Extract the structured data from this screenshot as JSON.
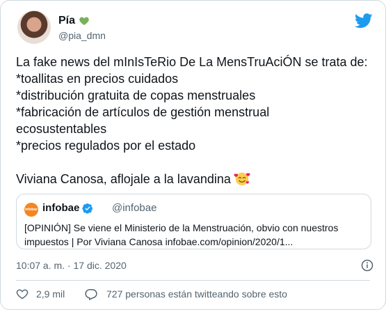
{
  "tweet": {
    "author_name": "Pía",
    "author_handle": "@pia_dmn",
    "text_lines": [
      "La fake news del mInIsTeRio De La MensTruAciÓN se trata de:",
      "*toallitas en precios cuidados",
      "*distribución gratuita de copas menstruales",
      "*fabricación de artículos de gestión menstrual",
      "ecosustentables",
      "*precios regulados por el estado"
    ],
    "closing_line": "Viviana Canosa, aflojale a la lavandina",
    "timestamp": "10:07 a. m. · 17 dic. 2020",
    "likes": "2,9 mil",
    "talking": "727 personas están twitteando sobre esto"
  },
  "quote": {
    "logo_text": "infobae",
    "name": "infobae",
    "handle": "@infobae",
    "text_lines": [
      "[OPINIÓN] Se viene el Ministerio de la Menstruación, obvio con nuestros",
      "impuestos | Por Viviana Canosa infobae.com/opinion/2020/1..."
    ]
  },
  "icons": {
    "heart": "green-heart-icon",
    "twitter": "twitter-bird-icon",
    "emoji": "smiling-face-with-hearts-icon",
    "verified": "verified-badge-icon",
    "info": "info-icon",
    "like": "heart-outline-icon",
    "reply": "reply-icon"
  },
  "colors": {
    "twitter_blue": "#1d9bf0",
    "heart_green": "#78b159",
    "secondary_text": "#536471",
    "infobae_orange": "#f5861f"
  }
}
